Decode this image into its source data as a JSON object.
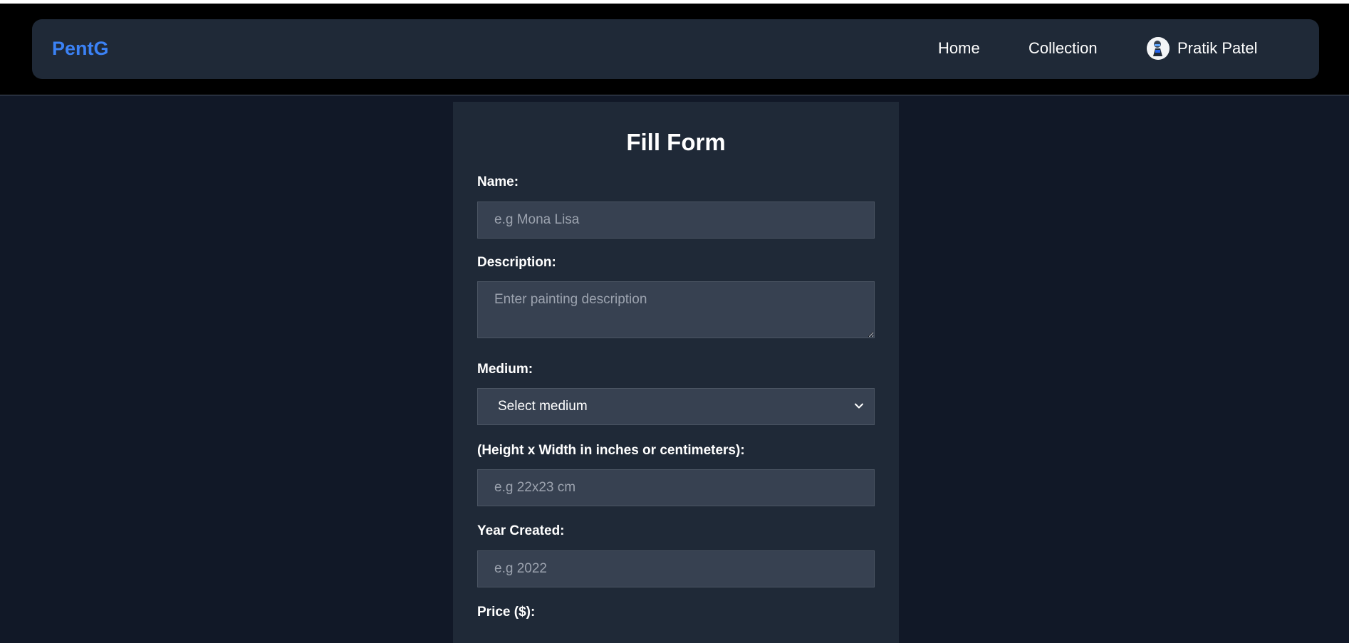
{
  "navbar": {
    "brand": "PentG",
    "links": [
      {
        "label": "Home"
      },
      {
        "label": "Collection"
      }
    ],
    "user": {
      "name": "Pratik Patel"
    }
  },
  "form": {
    "title": "Fill Form",
    "name": {
      "label": "Name:",
      "placeholder": "e.g Mona Lisa"
    },
    "description": {
      "label": "Description:",
      "placeholder": "Enter painting description"
    },
    "medium": {
      "label": "Medium:",
      "selected": "Select medium"
    },
    "dimensions": {
      "label": "(Height x Width in inches or centimeters):",
      "placeholder": "e.g 22x23 cm"
    },
    "year": {
      "label": "Year Created:",
      "placeholder": "e.g 2022"
    },
    "price": {
      "label": "Price ($):"
    }
  },
  "colors": {
    "brand": "#3b82f6",
    "page_background": "#111827",
    "card_background": "#1f2937",
    "input_background": "#374151"
  },
  "icons": {
    "avatar": "user-avatar-icon",
    "select": "chevron-down-icon"
  }
}
